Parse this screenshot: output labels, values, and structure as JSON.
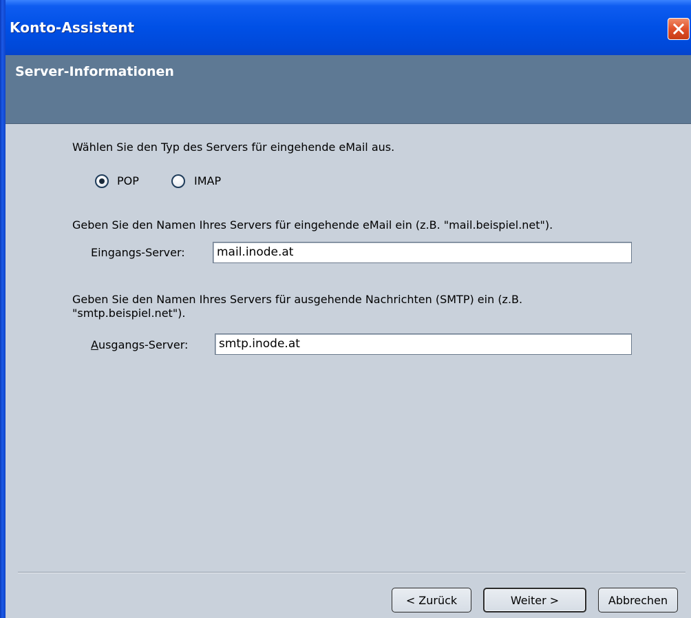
{
  "window": {
    "title": "Konto-Assistent"
  },
  "header": {
    "title": "Server-Informationen"
  },
  "incoming_type": {
    "prompt": "Wählen Sie den Typ des Servers für eingehende eMail aus.",
    "options": [
      {
        "label": "POP",
        "checked": true
      },
      {
        "label": "IMAP",
        "checked": false
      }
    ]
  },
  "incoming_server": {
    "prompt": "Geben Sie den Namen Ihres Servers für eingehende eMail ein (z.B. \"mail.beispiel.net\").",
    "label": "Eingangs-Server:",
    "value": "mail.inode.at"
  },
  "outgoing_server": {
    "prompt_line1": "Geben Sie den Namen Ihres Servers für ausgehende Nachrichten (SMTP) ein (z.B.",
    "prompt_line2": "\"smtp.beispiel.net\").",
    "label_first_char": "A",
    "label_rest": "usgangs-Server:",
    "value": "smtp.inode.at"
  },
  "buttons": {
    "back": "< Zurück",
    "next": "Weiter >",
    "cancel": "Abbrechen"
  },
  "colors": {
    "titlebar": "#0050e6",
    "header_band": "#5e7994",
    "panel": "#c9d1db"
  },
  "icons": {
    "close": "close-icon"
  }
}
